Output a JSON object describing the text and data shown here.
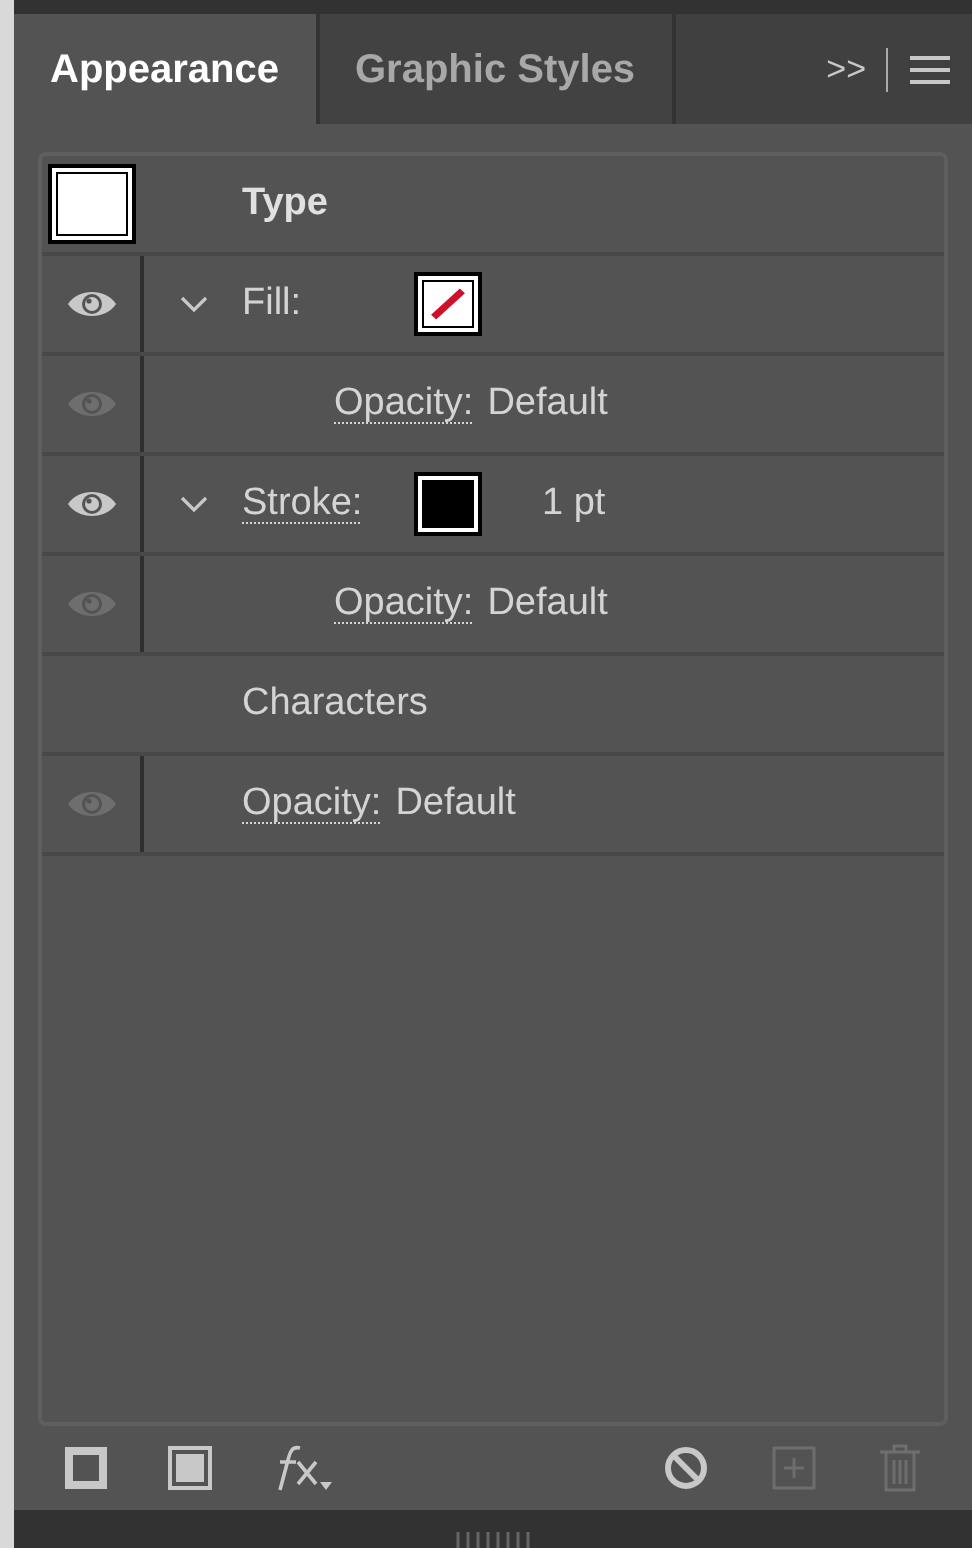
{
  "tabs": [
    {
      "label": "Appearance",
      "selected": true
    },
    {
      "label": "Graphic Styles",
      "selected": false
    }
  ],
  "overflow": ">>",
  "header": {
    "label": "Type",
    "swatch": {
      "kind": "solid",
      "color": "#ffffff"
    }
  },
  "items": [
    {
      "label": "Fill:",
      "linked": false,
      "visible": true,
      "expanded": true,
      "swatch": {
        "kind": "none"
      },
      "children": [
        {
          "label": "Opacity:",
          "value": "Default",
          "linked": true,
          "visible": false
        }
      ]
    },
    {
      "label": "Stroke:",
      "linked": true,
      "visible": true,
      "expanded": true,
      "swatch": {
        "kind": "solid",
        "color": "#000000"
      },
      "weight": "1 pt",
      "children": [
        {
          "label": "Opacity:",
          "value": "Default",
          "linked": true,
          "visible": false
        }
      ]
    },
    {
      "label": "Characters"
    },
    {
      "label": "Opacity:",
      "value": "Default",
      "linked": true,
      "visible": false
    }
  ]
}
